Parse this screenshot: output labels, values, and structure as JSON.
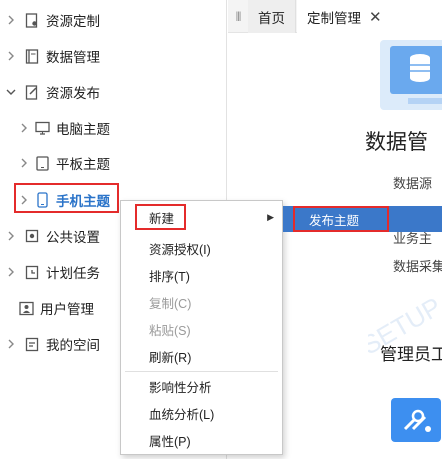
{
  "tree": {
    "items": [
      {
        "label": "资源定制",
        "icon": "doc-gear-icon",
        "expanded": false
      },
      {
        "label": "数据管理",
        "icon": "data-book-icon",
        "expanded": false
      },
      {
        "label": "资源发布",
        "icon": "publish-doc-icon",
        "expanded": true
      },
      {
        "label": "电脑主题",
        "icon": "monitor-icon",
        "expanded": false
      },
      {
        "label": "平板主题",
        "icon": "tablet-icon",
        "expanded": false
      },
      {
        "label": "手机主题",
        "icon": "phone-icon",
        "expanded": false
      },
      {
        "label": "公共设置",
        "icon": "gear-icon",
        "expanded": false
      },
      {
        "label": "计划任务",
        "icon": "clock-icon",
        "expanded": false
      },
      {
        "label": "用户管理",
        "icon": "user-card-icon",
        "expanded": false
      },
      {
        "label": "我的空间",
        "icon": "my-space-icon",
        "expanded": false
      }
    ]
  },
  "tabs": {
    "home": "首页",
    "current": "定制管理",
    "close_glyph": "✕",
    "grip_glyph": "|||"
  },
  "content": {
    "section1_title": "数据管",
    "section1_line1": "数据源",
    "section1_line2": "业务主",
    "section1_line3": "数据采集",
    "section2_title": "管理员工"
  },
  "context_menu": {
    "new": "新建",
    "grant": "资源授权(I)",
    "sort": "排序(T)",
    "copy": "复制(C)",
    "paste": "粘贴(S)",
    "refresh": "刷新(R)",
    "impact": "影响性分析",
    "lineage": "血统分析(L)",
    "properties": "属性(P)"
  },
  "submenu": {
    "publish": "发布主题"
  },
  "colors": {
    "accent": "#2b74c9",
    "highlight_box": "#e42b2b",
    "submenu_bg": "#3b78c9"
  }
}
